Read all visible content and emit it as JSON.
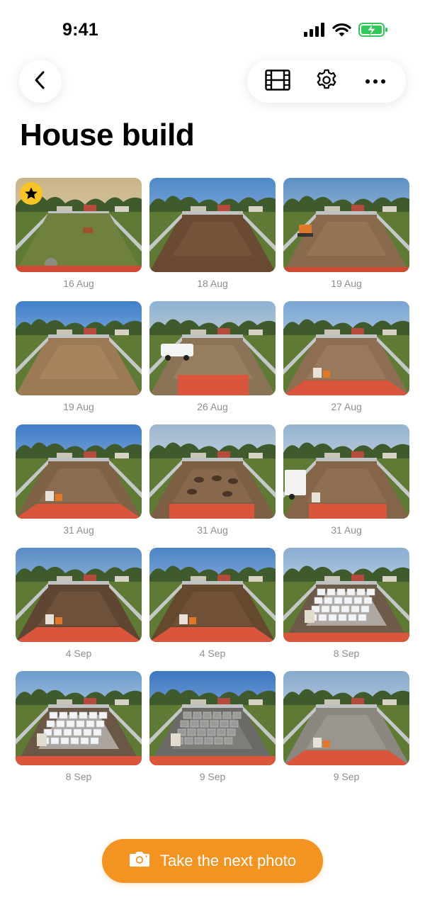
{
  "status_bar": {
    "time": "9:41"
  },
  "header": {
    "title": "House build",
    "icons": {
      "back": "chevron-left-icon",
      "film": "film-icon",
      "settings": "gear-icon",
      "more": "ellipsis-icon"
    }
  },
  "photos": [
    {
      "date": "16 Aug",
      "favorite": true,
      "scene": "grass"
    },
    {
      "date": "18 Aug",
      "favorite": false,
      "scene": "dirt-dark"
    },
    {
      "date": "19 Aug",
      "favorite": false,
      "scene": "dirt-excavator"
    },
    {
      "date": "19 Aug",
      "favorite": false,
      "scene": "dirt-flat"
    },
    {
      "date": "26 Aug",
      "favorite": false,
      "scene": "ute"
    },
    {
      "date": "27 Aug",
      "favorite": false,
      "scene": "dirt-tracks"
    },
    {
      "date": "31 Aug",
      "favorite": false,
      "scene": "dirt-roof"
    },
    {
      "date": "31 Aug",
      "favorite": false,
      "scene": "dirt-holes"
    },
    {
      "date": "31 Aug",
      "favorite": false,
      "scene": "truck"
    },
    {
      "date": "4 Sep",
      "favorite": false,
      "scene": "trench"
    },
    {
      "date": "4 Sep",
      "favorite": false,
      "scene": "trench-excavator"
    },
    {
      "date": "8 Sep",
      "favorite": false,
      "scene": "pods"
    },
    {
      "date": "8 Sep",
      "favorite": false,
      "scene": "pods-close"
    },
    {
      "date": "9 Sep",
      "favorite": false,
      "scene": "pour"
    },
    {
      "date": "9 Sep",
      "favorite": false,
      "scene": "slab"
    }
  ],
  "cta": {
    "label": "Take the next photo",
    "icon": "camera-icon"
  },
  "colors": {
    "accent": "#f39321",
    "favorite": "#f7c325",
    "date_text": "#8e8e93",
    "battery": "#34c759"
  }
}
